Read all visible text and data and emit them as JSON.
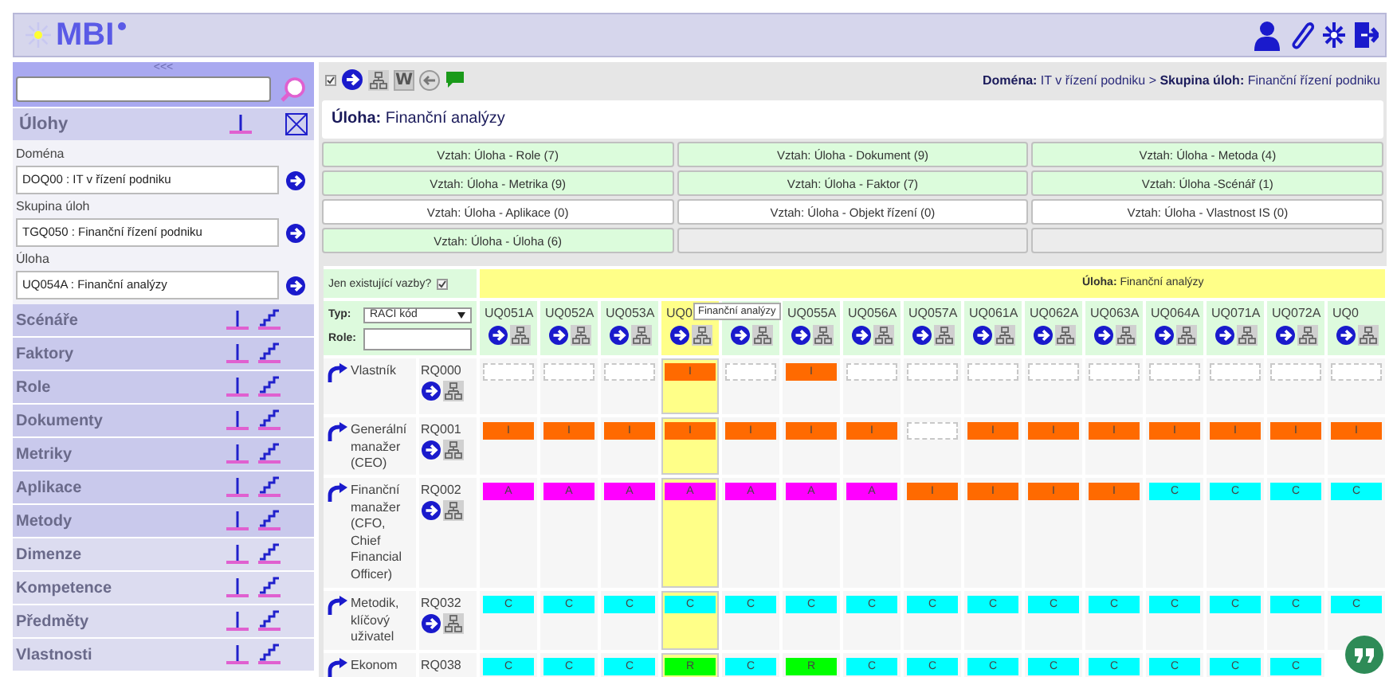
{
  "header": {
    "logo": "MBI"
  },
  "sidebar": {
    "collapse": "<<<",
    "section": "Úlohy",
    "filters": [
      {
        "label": "Doména",
        "value": "DOQ00 : IT v řízení podniku"
      },
      {
        "label": "Skupina úloh",
        "value": "TGQ050 : Finanční řízení podniku"
      },
      {
        "label": "Úloha",
        "value": "UQ054A : Finanční analýzy"
      }
    ],
    "items": [
      {
        "label": "Scénáře",
        "active": true
      },
      {
        "label": "Faktory",
        "active": true
      },
      {
        "label": "Role",
        "active": true
      },
      {
        "label": "Dokumenty",
        "active": true
      },
      {
        "label": "Metriky",
        "active": true
      },
      {
        "label": "Aplikace",
        "active": true
      },
      {
        "label": "Metody",
        "active": true
      },
      {
        "label": "Dimenze",
        "active": false
      },
      {
        "label": "Kompetence",
        "active": false
      },
      {
        "label": "Předměty",
        "active": false
      },
      {
        "label": "Vlastnosti",
        "active": false
      }
    ]
  },
  "toolbar": {
    "checked": true,
    "w_label": "W"
  },
  "breadcrumb": "**Doména:** IT v řízení podniku > **Skupina úloh:** Finanční řízení podniku",
  "title": "**Úloha:** Finanční analýzy",
  "relations": [
    {
      "label": "Vztah: Úloha - Role (7)",
      "active": true
    },
    {
      "label": "Vztah: Úloha - Dokument (9)",
      "active": true
    },
    {
      "label": "Vztah: Úloha - Metoda (4)",
      "active": true
    },
    {
      "label": "Vztah: Úloha - Metrika (9)",
      "active": true
    },
    {
      "label": "Vztah: Úloha - Faktor (7)",
      "active": true
    },
    {
      "label": "Vztah: Úloha -Scénář (1)",
      "active": true
    },
    {
      "label": "Vztah: Úloha - Aplikace (0)",
      "active": false
    },
    {
      "label": "Vztah: Úloha - Objekt řízení (0)",
      "active": false
    },
    {
      "label": "Vztah: Úloha - Vlastnost IS (0)",
      "active": false
    },
    {
      "label": "Vztah: Úloha - Úloha (6)",
      "active": true
    }
  ],
  "matrix": {
    "existing_only": {
      "label": "Jen existující vazby?",
      "checked": true
    },
    "banner": "**Úloha:** Finanční analýzy",
    "type_label": "Typ:",
    "type_value": "RACI kód",
    "role_label": "Role:",
    "tooltip": "Finanční analýzy",
    "columns": [
      {
        "code": "UQ051A",
        "selected": false
      },
      {
        "code": "UQ052A",
        "selected": false
      },
      {
        "code": "UQ053A",
        "selected": false
      },
      {
        "code": "UQ0",
        "selected": true
      },
      {
        "selected": false
      },
      {
        "code": "UQ055A",
        "selected": false
      },
      {
        "code": "UQ056A",
        "selected": false
      },
      {
        "code": "UQ057A",
        "selected": false
      },
      {
        "code": "UQ061A",
        "selected": false
      },
      {
        "code": "UQ062A",
        "selected": false
      },
      {
        "code": "UQ063A",
        "selected": false
      },
      {
        "code": "UQ064A",
        "selected": false
      },
      {
        "code": "UQ071A",
        "selected": false
      },
      {
        "code": "UQ072A",
        "selected": false
      },
      {
        "code": "UQ0",
        "selected": false
      }
    ],
    "rows": [
      {
        "name": "Vlastník",
        "code": "RQ000",
        "cells": [
          null,
          null,
          null,
          {
            "code": "I",
            "color": "#ff6a00"
          },
          null,
          {
            "code": "I",
            "color": "#ff6a00"
          },
          null,
          null,
          null,
          null,
          null,
          null,
          null,
          null,
          null
        ]
      },
      {
        "name": "Generální manažer (CEO)",
        "code": "RQ001",
        "cells": [
          {
            "code": "I",
            "color": "#ff6a00"
          },
          {
            "code": "I",
            "color": "#ff6a00"
          },
          {
            "code": "I",
            "color": "#ff6a00"
          },
          {
            "code": "I",
            "color": "#ff6a00"
          },
          {
            "code": "I",
            "color": "#ff6a00"
          },
          {
            "code": "I",
            "color": "#ff6a00"
          },
          {
            "code": "I",
            "color": "#ff6a00"
          },
          null,
          {
            "code": "I",
            "color": "#ff6a00"
          },
          {
            "code": "I",
            "color": "#ff6a00"
          },
          {
            "code": "I",
            "color": "#ff6a00"
          },
          {
            "code": "I",
            "color": "#ff6a00"
          },
          {
            "code": "I",
            "color": "#ff6a00"
          },
          {
            "code": "I",
            "color": "#ff6a00"
          },
          {
            "code": "I",
            "color": "#ff6a00"
          }
        ]
      },
      {
        "name": "Finanční manažer (CFO, Chief Financial Officer)",
        "code": "RQ002",
        "cells": [
          {
            "code": "A",
            "color": "#ff00ff"
          },
          {
            "code": "A",
            "color": "#ff00ff"
          },
          {
            "code": "A",
            "color": "#ff00ff"
          },
          {
            "code": "A",
            "color": "#ff00ff"
          },
          {
            "code": "A",
            "color": "#ff00ff"
          },
          {
            "code": "A",
            "color": "#ff00ff"
          },
          {
            "code": "A",
            "color": "#ff00ff"
          },
          {
            "code": "I",
            "color": "#ff6a00"
          },
          {
            "code": "I",
            "color": "#ff6a00"
          },
          {
            "code": "I",
            "color": "#ff6a00"
          },
          {
            "code": "I",
            "color": "#ff6a00"
          },
          {
            "code": "C",
            "color": "#00ffff"
          },
          {
            "code": "C",
            "color": "#00ffff"
          },
          {
            "code": "C",
            "color": "#00ffff"
          },
          {
            "code": "C",
            "color": "#00ffff"
          }
        ]
      },
      {
        "name": "Metodik, klíčový uživatel",
        "code": "RQ032",
        "cells": [
          {
            "code": "C",
            "color": "#00ffff"
          },
          {
            "code": "C",
            "color": "#00ffff"
          },
          {
            "code": "C",
            "color": "#00ffff"
          },
          {
            "code": "C",
            "color": "#00ffff"
          },
          {
            "code": "C",
            "color": "#00ffff"
          },
          {
            "code": "C",
            "color": "#00ffff"
          },
          {
            "code": "C",
            "color": "#00ffff"
          },
          {
            "code": "C",
            "color": "#00ffff"
          },
          {
            "code": "C",
            "color": "#00ffff"
          },
          {
            "code": "C",
            "color": "#00ffff"
          },
          {
            "code": "C",
            "color": "#00ffff"
          },
          {
            "code": "C",
            "color": "#00ffff"
          },
          {
            "code": "C",
            "color": "#00ffff"
          },
          {
            "code": "C",
            "color": "#00ffff"
          },
          {
            "code": "C",
            "color": "#00ffff"
          }
        ]
      },
      {
        "name": "Ekonom",
        "code": "RQ038",
        "cells": [
          {
            "code": "C",
            "color": "#00ffff"
          },
          {
            "code": "C",
            "color": "#00ffff"
          },
          {
            "code": "C",
            "color": "#00ffff"
          },
          {
            "code": "R",
            "color": "#00ff00"
          },
          {
            "code": "C",
            "color": "#00ffff"
          },
          {
            "code": "R",
            "color": "#00ff00"
          },
          {
            "code": "C",
            "color": "#00ffff"
          },
          {
            "code": "C",
            "color": "#00ffff"
          },
          {
            "code": "C",
            "color": "#00ffff"
          },
          {
            "code": "C",
            "color": "#00ffff"
          },
          {
            "code": "C",
            "color": "#00ffff"
          },
          {
            "code": "C",
            "color": "#00ffff"
          },
          {
            "code": "C",
            "color": "#00ffff"
          },
          {
            "code": "C",
            "color": "#00ffff"
          }
        ]
      }
    ]
  }
}
